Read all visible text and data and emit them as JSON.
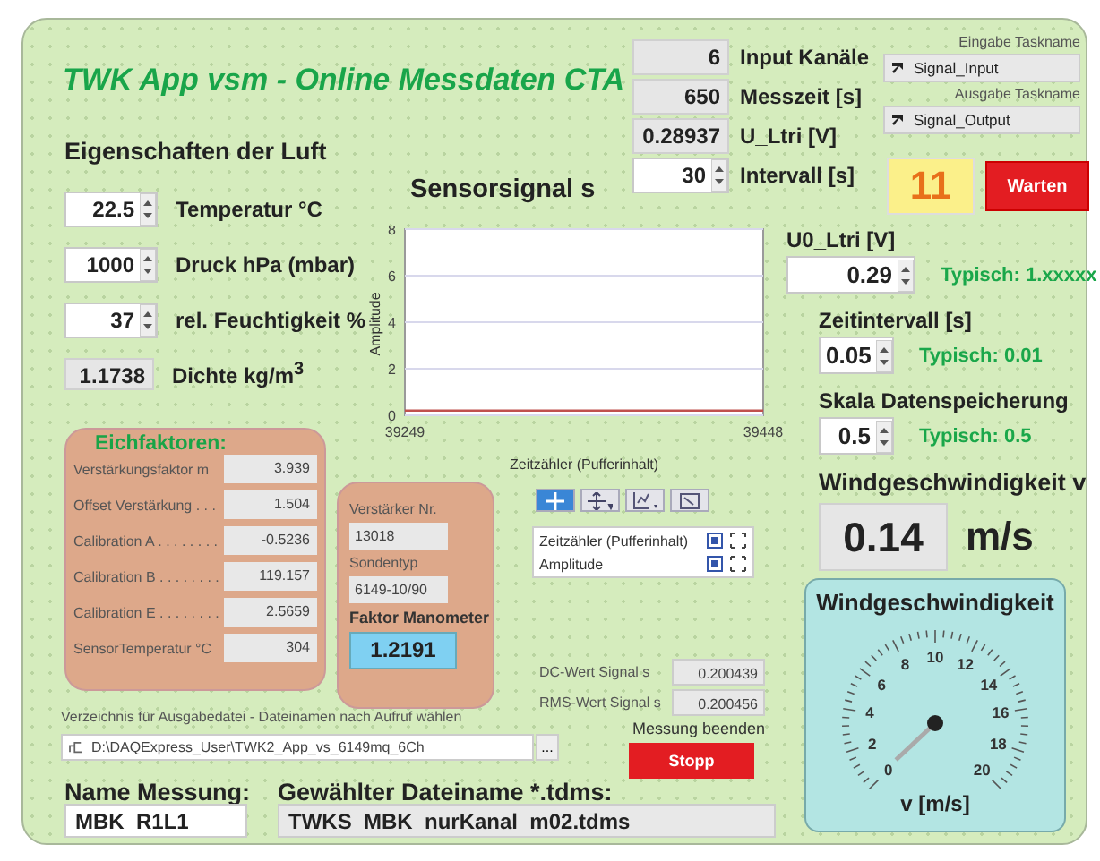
{
  "title": "TWK App vsm - Online Messdaten CTA",
  "air": {
    "heading": "Eigenschaften der Luft",
    "rows": [
      {
        "kind": "numeric",
        "value": "22.5",
        "label": "Temperatur °C"
      },
      {
        "kind": "numeric",
        "value": "1000",
        "label": "Druck hPa (mbar)"
      },
      {
        "kind": "numeric",
        "value": "37",
        "label": "rel. Feuchtigkeit %"
      },
      {
        "kind": "indicator",
        "value": "1.1738",
        "label": "Dichte kg/m$^{3}$"
      }
    ]
  },
  "status": [
    {
      "kind": "indicator",
      "value": "6",
      "label": "Input Kanäle"
    },
    {
      "kind": "indicator",
      "value": "650",
      "label": "Messzeit [s]"
    },
    {
      "kind": "indicator",
      "value": "0.28937",
      "label": "U_Ltri [V]"
    },
    {
      "kind": "numeric",
      "value": "30",
      "label": "Intervall [s]"
    }
  ],
  "tasks": [
    {
      "caption": "Eingabe Taskname",
      "value": "Signal_Input"
    },
    {
      "caption": "Ausgabe Taskname",
      "value": "Signal_Output"
    }
  ],
  "counter": "11",
  "wait_button": "Warten",
  "chart": {
    "title": "Sensorsignal s",
    "chart_data": {
      "type": "line",
      "xlabel": "Zeitzähler (Pufferinhalt)",
      "ylabel": "Amplitude",
      "x": [
        39249,
        39448
      ],
      "values": [
        0.2,
        0.2
      ],
      "xlim": [
        39249,
        39448
      ],
      "ylim": [
        0,
        8
      ],
      "grid": true,
      "xticks": [
        39249,
        39448
      ],
      "yticks": [
        0,
        2,
        4,
        6,
        8
      ]
    }
  },
  "graph_tools": [
    {
      "kind": "cursor",
      "selected": true
    },
    {
      "kind": "pan",
      "selected": false
    },
    {
      "kind": "zoom",
      "selected": false
    },
    {
      "kind": "zoom-out",
      "selected": false
    }
  ],
  "scale_legend": [
    "Zeitzähler (Pufferinhalt)",
    "Amplitude"
  ],
  "settings": [
    {
      "label": "U0_Ltri [V]",
      "value": "0.29",
      "hint": "Typisch: 1.xxxxx"
    },
    {
      "label": "Zeitintervall [s]",
      "value": "0.05",
      "hint": "Typisch: 0.01"
    },
    {
      "label": "Skala Datenspeicherung",
      "value": "0.5",
      "hint": "Typisch: 0.5"
    }
  ],
  "wind": {
    "heading": "Windgeschwindigkeit v",
    "value": "0.14",
    "unit": "m/s"
  },
  "gauge": {
    "title": "Windgeschwindigkeit",
    "ticks": [
      "0",
      "2",
      "4",
      "6",
      "8",
      "10",
      "12",
      "14",
      "16",
      "18",
      "20"
    ],
    "unit": "v [m/s]"
  },
  "calibration": {
    "title": "Eichfaktoren:",
    "rows": [
      {
        "label": "Verstärkungsfaktor m",
        "value": "3.939"
      },
      {
        "label": "Offset Verstärkung . . .",
        "value": "1.504"
      },
      {
        "label": "Calibration A . . . . . . . .",
        "value": "-0.5236"
      },
      {
        "label": "Calibration B . . . . . . . .",
        "value": "119.157"
      },
      {
        "label": "Calibration E . . . . . . . .",
        "value": "2.5659"
      },
      {
        "label": "SensorTemperatur °C",
        "value": "304"
      }
    ]
  },
  "amplifier": {
    "number_label": "Verstärker Nr.",
    "number": "13018",
    "probe_label": "Sondentyp",
    "probe": "6149-10/90",
    "factor_label": "Faktor Manometer",
    "factor": "1.2191"
  },
  "signal_values": [
    {
      "label": "DC-Wert Signal s",
      "value": "0.200439"
    },
    {
      "label": "RMS-Wert Signal s",
      "value": "0.200456"
    }
  ],
  "stop": {
    "caption": "Messung beenden",
    "button": "Stopp"
  },
  "output_path": {
    "caption": "Verzeichnis für Ausgabedatei - Dateinamen nach Aufruf wählen",
    "value": "D:\\DAQExpress_User\\TWK2_App_vs_6149mq_6Ch",
    "browse": "..."
  },
  "measurement_name": {
    "label": "Name Messung:",
    "value": "MBK_R1L1"
  },
  "file_name": {
    "label": "Gewählter Dateiname *.tdms:",
    "value": "TWKS_MBK_nurKanal_m02.tdms"
  }
}
